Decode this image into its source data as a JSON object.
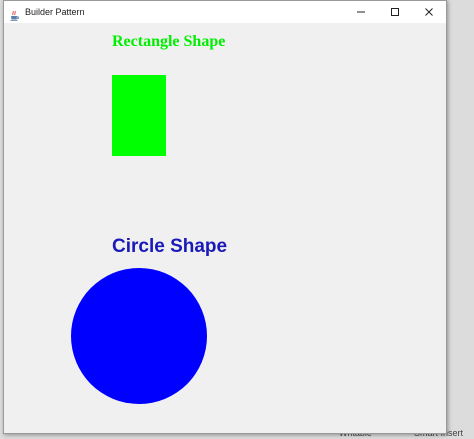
{
  "window": {
    "title": "Builder Pattern",
    "controls": {
      "minimize_icon": "minimize-icon",
      "maximize_icon": "maximize-icon",
      "close_icon": "close-icon"
    }
  },
  "canvas": {
    "rectangle": {
      "label": "Rectangle Shape",
      "label_color": "#00ee00",
      "fill_color": "#00ff00"
    },
    "circle": {
      "label": "Circle Shape",
      "label_color": "#1a1ab8",
      "fill_color": "#0000ff"
    }
  },
  "background_window": {
    "status_left": "Writable",
    "status_right": "Smart Insert"
  }
}
